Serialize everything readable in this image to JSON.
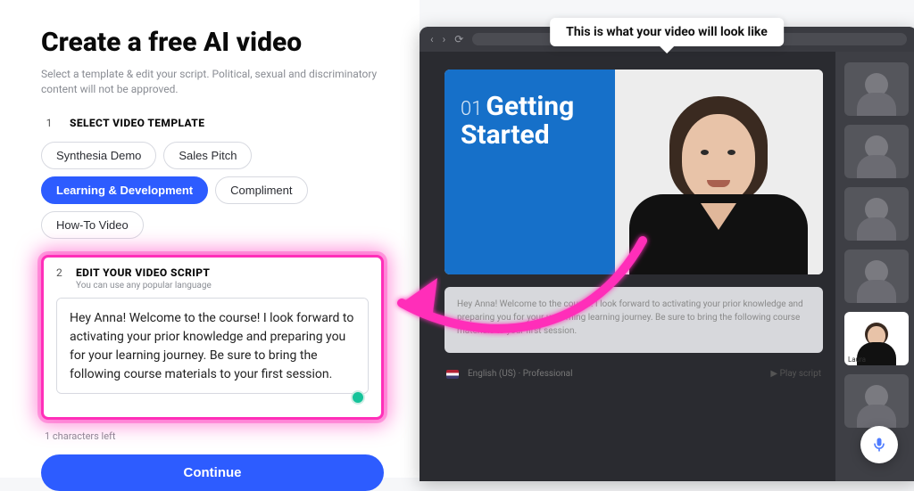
{
  "colors": {
    "accent": "#2d5cff",
    "highlight": "#ff2fb9"
  },
  "left": {
    "title": "Create a free AI video",
    "subtitle": "Select a template & edit your script. Political, sexual and discriminatory content will not be approved.",
    "step1": {
      "num": "1",
      "label": "SELECT VIDEO TEMPLATE"
    },
    "templates": [
      {
        "label": "Synthesia Demo",
        "active": false
      },
      {
        "label": "Sales Pitch",
        "active": false
      },
      {
        "label": "Learning & Development",
        "active": true
      },
      {
        "label": "Compliment",
        "active": false
      },
      {
        "label": "How-To Video",
        "active": false
      }
    ],
    "step2": {
      "num": "2",
      "label": "EDIT YOUR VIDEO SCRIPT",
      "hint": "You can use any popular language",
      "value": "Hey Anna! Welcome to the course! I look forward to activating your prior knowledge and preparing you for your learning journey. Be sure to bring the following course materials to your first session."
    },
    "chars_left": "1 characters left",
    "continue": "Continue"
  },
  "right": {
    "tooltip": "This is what your video will look like",
    "slide": {
      "num": "01",
      "title_line1": "Getting",
      "title_line2": "Started"
    },
    "script_preview": "Hey Anna! Welcome to the course! I look forward to activating your prior knowledge and preparing you for your upcoming learning journey. Be sure to bring the following course materials to your first session.",
    "language": "English (US) · Professional",
    "play": "▶  Play script",
    "selected_avatar": "Laura",
    "avatars": [
      "",
      "",
      "",
      "",
      "Laura",
      ""
    ]
  }
}
